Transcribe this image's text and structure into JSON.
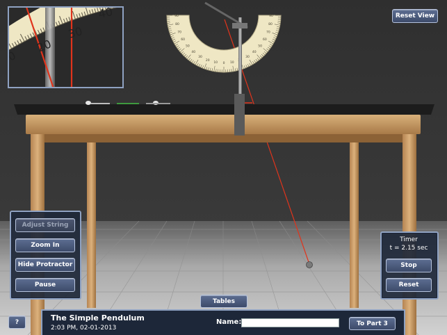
{
  "controls": {
    "adjust_string": "Adjust String",
    "zoom_in": "Zoom In",
    "hide_protractor": "Hide Protractor",
    "pause": "Pause"
  },
  "timer": {
    "title": "Timer",
    "readout": "t = 2.15 sec",
    "stop": "Stop",
    "reset": "Reset"
  },
  "reset_view": "Reset View",
  "help": "?",
  "tables": "Tables",
  "footer": {
    "title": "The Simple Pendulum",
    "datetime": "2:03 PM, 02-01-2013",
    "name_label": "Name:",
    "name_value": "",
    "next": "To Part 3"
  },
  "zoom_scale_labels": [
    "0",
    "20",
    "30",
    "40"
  ],
  "protractor_labels": [
    "90",
    "80",
    "70",
    "60",
    "50",
    "40",
    "30",
    "20",
    "10",
    "0",
    "10",
    "20",
    "30",
    "40",
    "50",
    "60",
    "70",
    "80",
    "90"
  ],
  "colors": {
    "panel_bg": "#1e283a",
    "panel_border": "#8fa2c2",
    "button": "#4d5c7e",
    "string": "#e0341c",
    "table_top": "#c49a66",
    "protractor": "#efe7c4"
  }
}
